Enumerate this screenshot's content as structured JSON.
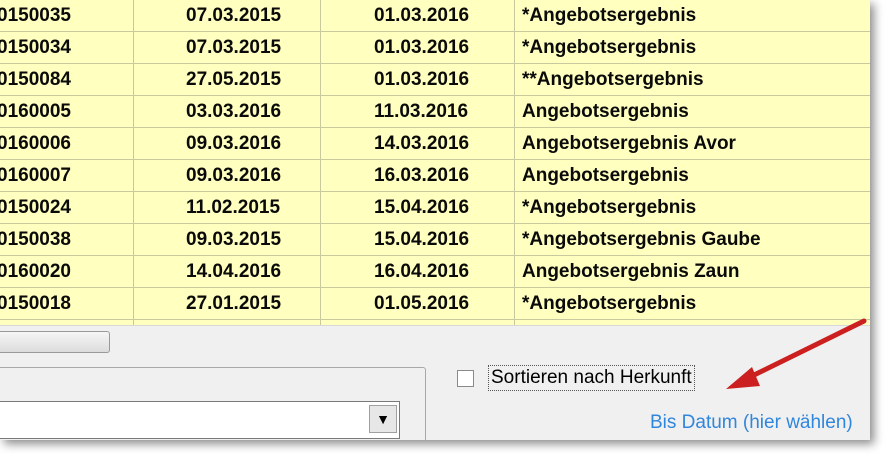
{
  "rows": [
    {
      "id": "0150035",
      "date1": "07.03.2015",
      "date2": "01.03.2016",
      "desc": "*Angebotsergebnis"
    },
    {
      "id": "0150034",
      "date1": "07.03.2015",
      "date2": "01.03.2016",
      "desc": "*Angebotsergebnis"
    },
    {
      "id": "0150084",
      "date1": "27.05.2015",
      "date2": "01.03.2016",
      "desc": "**Angebotsergebnis"
    },
    {
      "id": "0160005",
      "date1": "03.03.2016",
      "date2": "11.03.2016",
      "desc": "Angebotsergebnis"
    },
    {
      "id": "0160006",
      "date1": "09.03.2016",
      "date2": "14.03.2016",
      "desc": "Angebotsergebnis Avor"
    },
    {
      "id": "0160007",
      "date1": "09.03.2016",
      "date2": "16.03.2016",
      "desc": "Angebotsergebnis"
    },
    {
      "id": "0150024",
      "date1": "11.02.2015",
      "date2": "15.04.2016",
      "desc": "*Angebotsergebnis"
    },
    {
      "id": "0150038",
      "date1": "09.03.2015",
      "date2": "15.04.2016",
      "desc": "*Angebotsergebnis Gaube"
    },
    {
      "id": "0160020",
      "date1": "14.04.2016",
      "date2": "16.04.2016",
      "desc": "Angebotsergebnis Zaun"
    },
    {
      "id": "0150018",
      "date1": "27.01.2015",
      "date2": "01.05.2016",
      "desc": "*Angebotsergebnis"
    }
  ],
  "sort_checkbox": {
    "label": "Sortieren nach Herkunft",
    "checked": false
  },
  "combo": {
    "value": "",
    "arrow_icon": "chevron-down-icon"
  },
  "date_link": {
    "label": "Bis Datum (hier wählen)"
  },
  "colors": {
    "grid_bg": "#ffffc0",
    "link": "#2f86dd",
    "arrow": "#cc2020"
  }
}
